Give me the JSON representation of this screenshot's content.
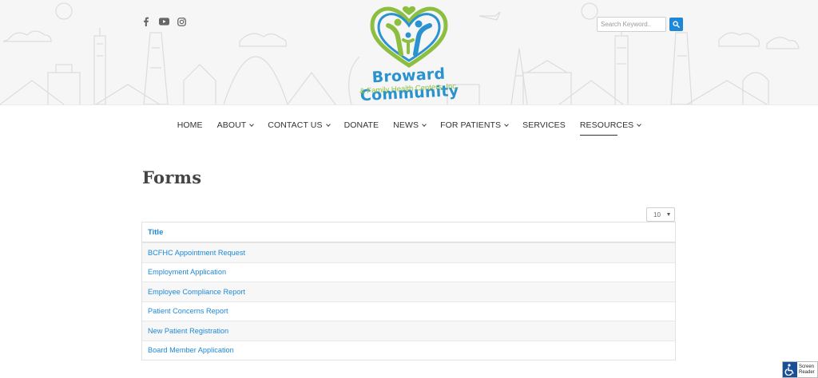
{
  "header": {
    "logo_title": "Broward Community",
    "logo_subtitle": "& Family Health Centers, Inc.",
    "social_icons": [
      "facebook-icon",
      "youtube-icon",
      "instagram-icon"
    ],
    "search": {
      "placeholder": "Search Keyword..",
      "button_icon": "search-icon"
    },
    "colors": {
      "brand_blue": "#1e88d6",
      "brand_green": "#8cbf3f"
    }
  },
  "nav": {
    "items": [
      {
        "label": "HOME",
        "dropdown": false
      },
      {
        "label": "ABOUT",
        "dropdown": true
      },
      {
        "label": "CONTACT US",
        "dropdown": true
      },
      {
        "label": "DONATE",
        "dropdown": false
      },
      {
        "label": "NEWS",
        "dropdown": true
      },
      {
        "label": "FOR PATIENTS",
        "dropdown": true
      },
      {
        "label": "SERVICES",
        "dropdown": false
      },
      {
        "label": "RESOURCES",
        "dropdown": true,
        "active": true
      }
    ]
  },
  "main": {
    "title": "Forms",
    "per_page": "10",
    "table": {
      "header": "Title",
      "rows": [
        "BCFHC Appointment Request",
        "Employment Application",
        "Employee Compliance Report",
        "Patient Concerns Report",
        "New Patient Registration",
        "Board Member Application"
      ]
    }
  },
  "screen_reader": {
    "line1": "Screen",
    "line2": "Reader"
  }
}
